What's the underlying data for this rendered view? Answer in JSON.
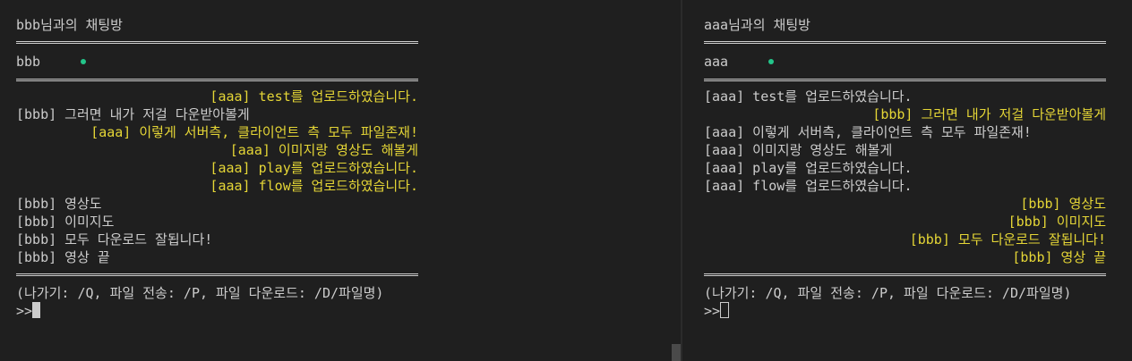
{
  "left": {
    "title": "bbb님과의 채팅방",
    "peer_name": "bbb",
    "separator": "================================================",
    "messages": [
      "[aaa] test를 업로드하였습니다.",
      "[bbb] 그러면 내가 저걸 다운받아볼게",
      "[aaa] 이렇게 서버측, 클라이언트 측 모두 파일존재!",
      "[aaa] 이미지랑 영상도 해볼게",
      "[aaa] play를 업로드하였습니다.",
      "[aaa] flow를 업로드하였습니다.",
      "[bbb] 영상도",
      "[bbb] 이미지도",
      "[bbb] 모두 다운로드 잘됩니다!",
      "[bbb] 영상 끝"
    ],
    "help": "(나가기: /Q, 파일 전송: /P, 파일 다운로드: /D/파일명)",
    "prompt": ">>"
  },
  "right": {
    "title": "aaa님과의 채팅방",
    "peer_name": "aaa",
    "separator": "================================================",
    "messages": [
      "[aaa] test를 업로드하였습니다.",
      "[bbb] 그러면 내가 저걸 다운받아볼게",
      "[aaa] 이렇게 서버측, 클라이언트 측 모두 파일존재!",
      "[aaa] 이미지랑 영상도 해볼게",
      "[aaa] play를 업로드하였습니다.",
      "[aaa] flow를 업로드하였습니다.",
      "[bbb] 영상도",
      "[bbb] 이미지도",
      "[bbb] 모두 다운로드 잘됩니다!",
      "[bbb] 영상 끝"
    ],
    "help": "(나가기: /Q, 파일 전송: /P, 파일 다운로드: /D/파일명)",
    "prompt": ">>"
  },
  "colors": {
    "background": "#1f1f1f",
    "text": "#cccccc",
    "own_message": "#e5d636",
    "online_dot": "#23c58a"
  }
}
